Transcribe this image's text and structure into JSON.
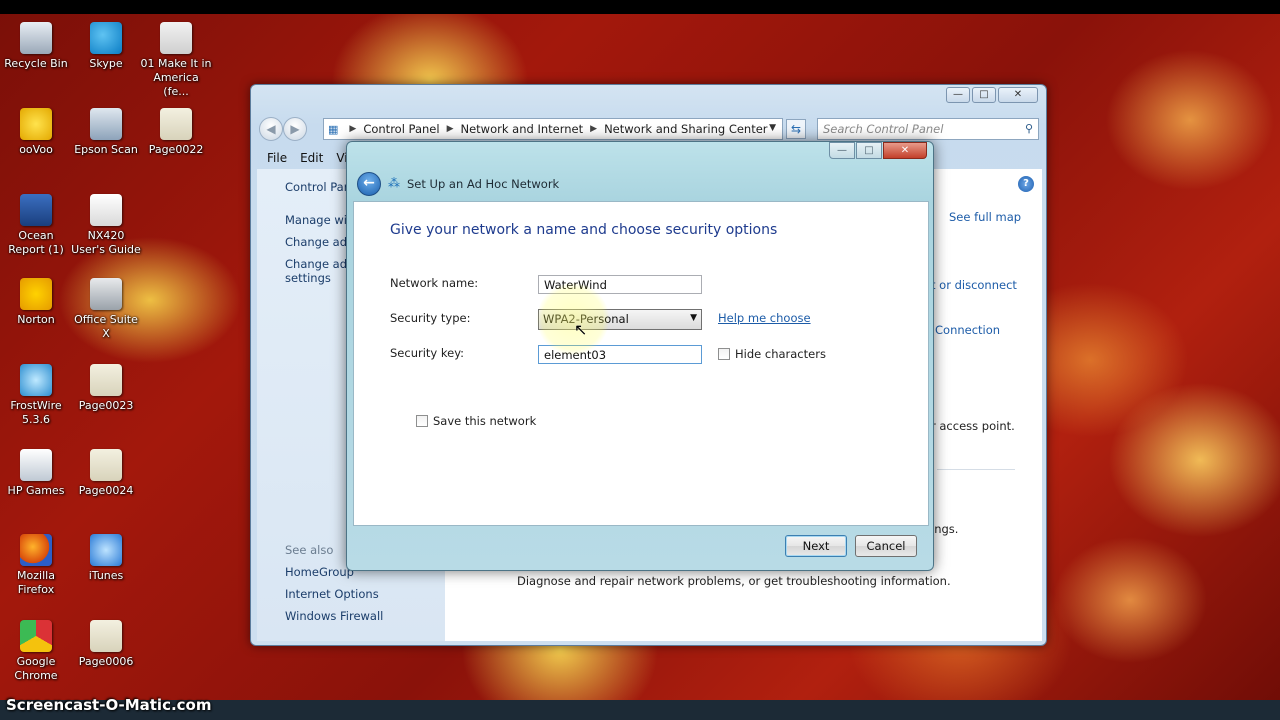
{
  "desktop_icons": [
    {
      "label": "Recycle Bin",
      "icon": "recycle-bin-icon"
    },
    {
      "label": "Skype",
      "icon": "skype-icon"
    },
    {
      "label": "01 Make It in America (fe...",
      "icon": "media-file-icon"
    },
    {
      "label": "ooVoo",
      "icon": "oovoo-icon"
    },
    {
      "label": "Epson Scan",
      "icon": "epson-scan-icon"
    },
    {
      "label": "Page0022",
      "icon": "image-file-icon"
    },
    {
      "label": "Ocean Report (1)",
      "icon": "shortcut-icon"
    },
    {
      "label": "NX420 User's Guide",
      "icon": "document-icon"
    },
    {
      "label": "Norton",
      "icon": "norton-icon"
    },
    {
      "label": "Office Suite X",
      "icon": "office-icon"
    },
    {
      "label": "FrostWire 5.3.6",
      "icon": "frostwire-icon"
    },
    {
      "label": "Page0023",
      "icon": "image-file-icon"
    },
    {
      "label": "HP Games",
      "icon": "hp-games-icon"
    },
    {
      "label": "Page0024",
      "icon": "image-file-icon"
    },
    {
      "label": "Mozilla Firefox",
      "icon": "firefox-icon"
    },
    {
      "label": "iTunes",
      "icon": "itunes-icon"
    },
    {
      "label": "Google Chrome",
      "icon": "chrome-icon"
    },
    {
      "label": "Page0006",
      "icon": "image-file-icon"
    }
  ],
  "explorer": {
    "breadcrumb": [
      "Control Panel",
      "Network and Internet",
      "Network and Sharing Center"
    ],
    "search_placeholder": "Search Control Panel",
    "menu": [
      "File",
      "Edit",
      "Vie"
    ],
    "left_pane": {
      "home": "Control Panel",
      "links": [
        "Manage wire",
        "Change adap",
        "Change adva",
        "settings"
      ],
      "see_also_heading": "See also",
      "see_also": [
        "HomeGroup",
        "Internet Options",
        "Windows Firewall"
      ]
    },
    "right_fragments": {
      "see_full_map": "See full map",
      "connect_disconnect": "t or disconnect",
      "connection": "Connection",
      "access_point": "r access point.",
      "settings_frag": "ings.",
      "diagnose": "Diagnose and repair network problems, or get troubleshooting information."
    }
  },
  "dialog": {
    "title": "Set Up an Ad Hoc Network",
    "heading": "Give your network a name and choose security options",
    "network_name_label": "Network name:",
    "network_name_value": "WaterWind",
    "security_type_label": "Security type:",
    "security_type_value": "WPA2-Personal",
    "help_link": "Help me choose",
    "security_key_label": "Security key:",
    "security_key_value": "element03",
    "hide_characters": "Hide characters",
    "save_network": "Save this network",
    "next": "Next",
    "cancel": "Cancel"
  },
  "watermark": "Screencast-O-Matic.com"
}
